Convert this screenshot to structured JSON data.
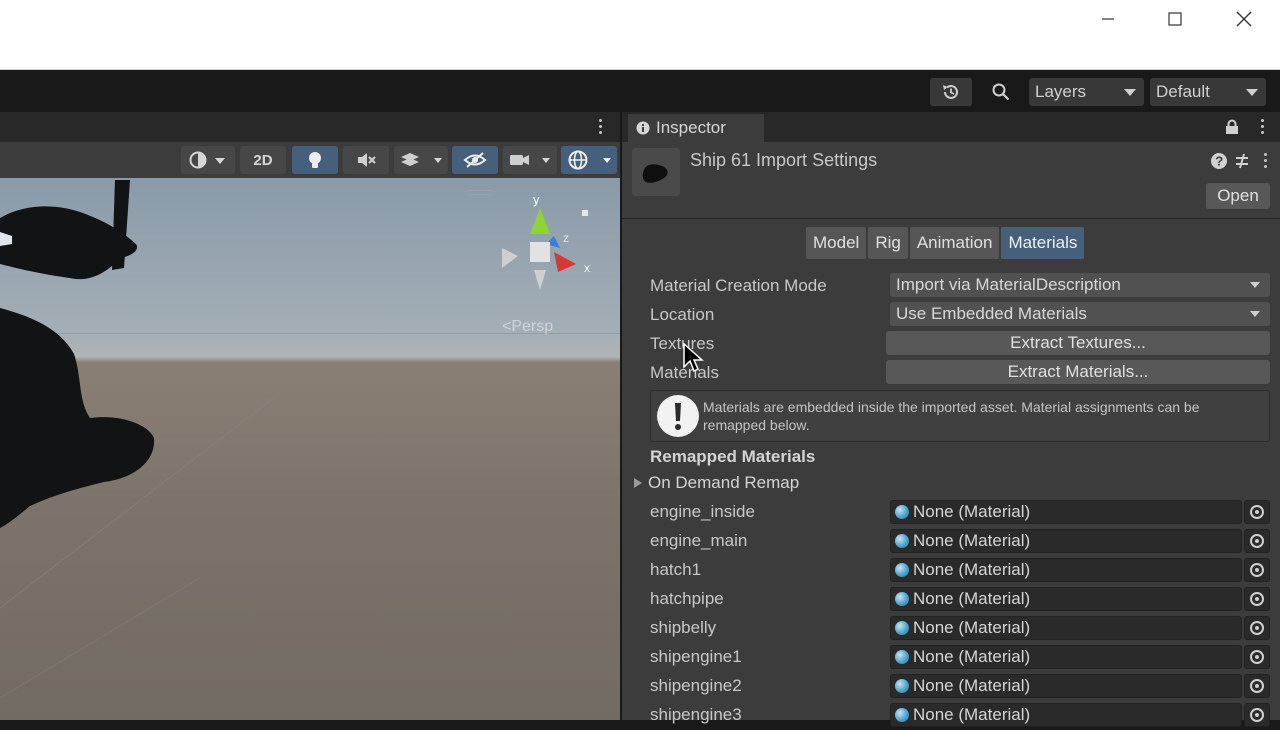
{
  "window": {
    "minimize_glyph": "—",
    "maximize_glyph": "☐",
    "close_glyph": "✕"
  },
  "toolbar": {
    "layers_label": "Layers",
    "layout_label": "Default"
  },
  "scene": {
    "toggle_2d_label": "2D",
    "persp_label": "<Persp",
    "gizmo_y": "y",
    "gizmo_z": "z",
    "gizmo_x": "x"
  },
  "inspector": {
    "tab_label": "Inspector",
    "asset_title": "Ship 61 Import Settings",
    "open_label": "Open",
    "tabs": [
      {
        "label": "Model",
        "active": false
      },
      {
        "label": "Rig",
        "active": false
      },
      {
        "label": "Animation",
        "active": false
      },
      {
        "label": "Materials",
        "active": true
      }
    ],
    "material_creation_mode": {
      "label": "Material Creation Mode",
      "value": "Import via MaterialDescription"
    },
    "location": {
      "label": "Location",
      "value": "Use Embedded Materials"
    },
    "textures": {
      "label": "Textures",
      "button": "Extract Textures..."
    },
    "materials": {
      "label": "Materials",
      "button": "Extract Materials..."
    },
    "info_message": "Materials are embedded inside the imported asset. Material assignments can be remapped below.",
    "remapped_title": "Remapped Materials",
    "on_demand_remap": "On Demand Remap",
    "remap_rows": [
      {
        "name": "engine_inside",
        "value": "None (Material)"
      },
      {
        "name": "engine_main",
        "value": "None (Material)"
      },
      {
        "name": "hatch1",
        "value": "None (Material)"
      },
      {
        "name": "hatchpipe",
        "value": "None (Material)"
      },
      {
        "name": "shipbelly",
        "value": "None (Material)"
      },
      {
        "name": "shipengine1",
        "value": "None (Material)"
      },
      {
        "name": "shipengine2",
        "value": "None (Material)"
      },
      {
        "name": "shipengine3",
        "value": "None (Material)"
      }
    ]
  },
  "colors": {
    "active_tab": "#46607c",
    "panel_bg": "#3c3c3c",
    "gizmo_x": "#d23a33",
    "gizmo_y": "#8fd436",
    "gizmo_z": "#3d7fd6"
  }
}
